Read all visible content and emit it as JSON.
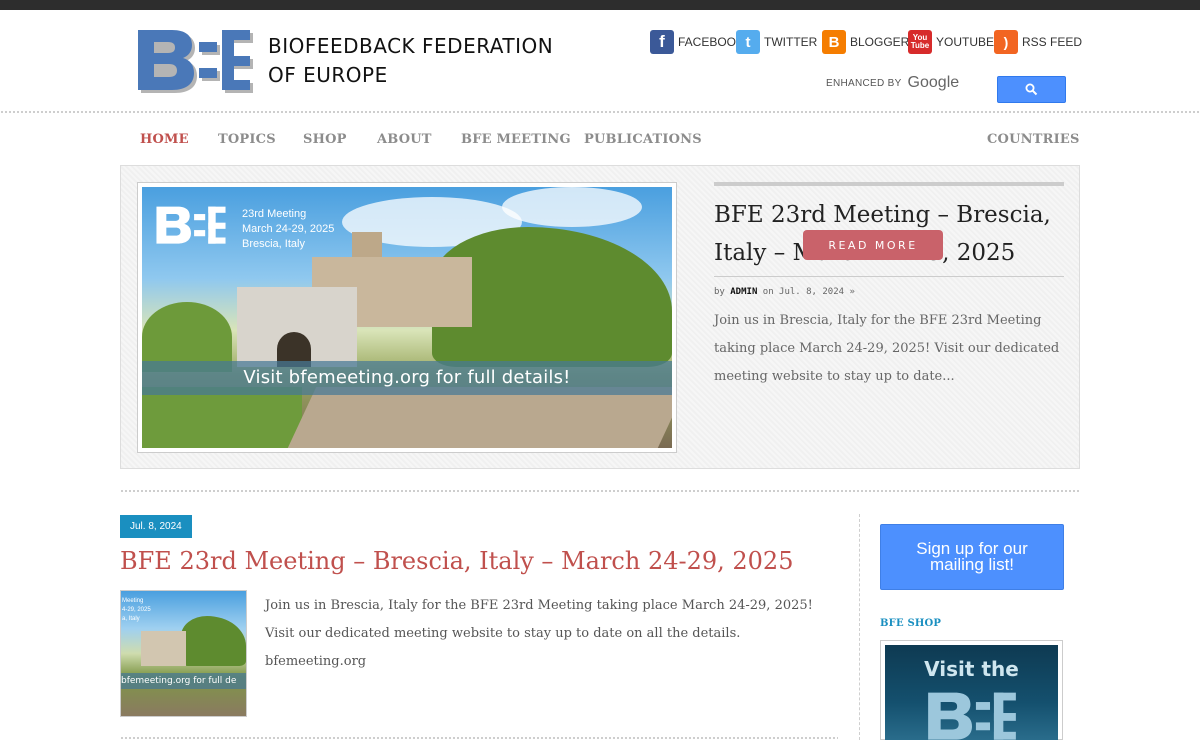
{
  "site": {
    "title_line1": "BIOFEEDBACK FEDERATION",
    "title_line2": "OF EUROPE"
  },
  "social": [
    {
      "label": "FACEBOOK",
      "icon": "facebook-icon"
    },
    {
      "label": "TWITTER",
      "icon": "twitter-icon"
    },
    {
      "label": "BLOGGER",
      "icon": "blogger-icon"
    },
    {
      "label": "YOUTUBE",
      "icon": "youtube-icon"
    },
    {
      "label": "RSS FEED",
      "icon": "rss-icon"
    }
  ],
  "search": {
    "enhanced_by": "ENHANCED BY",
    "provider": "Google"
  },
  "nav": {
    "home": "HOME",
    "topics": "TOPICS",
    "shop": "SHOP",
    "about": "ABOUT",
    "meeting": "BFE MEETING",
    "publications": "PUBLICATIONS",
    "countries": "COUNTRIES"
  },
  "feature": {
    "image": {
      "meeting_line1": "23rd Meeting",
      "meeting_line2": "March 24-29, 2025",
      "meeting_line3": "Brescia, Italy",
      "banner": "Visit bfemeeting.org for full details!"
    },
    "title": "BFE 23rd Meeting – Brescia, Italy – March 24-29, 2025",
    "meta_by": "by",
    "meta_author": "ADMIN",
    "meta_on": "on Jul. 8, 2024 »",
    "excerpt": "Join us in Brescia, Italy for the BFE 23rd Meeting taking place March 24-29, 2025! Visit our dedicated meeting website to stay up to date...",
    "read_more": "READ MORE"
  },
  "post": {
    "date": "Jul. 8, 2024",
    "title": "BFE 23rd Meeting – Brescia, Italy – March 24-29, 2025",
    "thumb_lines": [
      "Meeting",
      "4-29, 2025",
      "a, Italy"
    ],
    "thumb_banner": "bfemeeting.org for full de",
    "excerpt": "Join us in Brescia, Italy for the BFE 23rd Meeting taking place March 24-29, 2025! Visit our dedicated meeting website to stay up to date on all the details. bfemeeting.org"
  },
  "sidebar": {
    "signup": "Sign up for our mailing list!",
    "shop_heading": "BFE SHOP",
    "shop_image_text": "Visit the"
  },
  "colors": {
    "accent_red": "#c0504d",
    "accent_blue": "#1a8fc0",
    "button_blue": "#4d90fe"
  }
}
